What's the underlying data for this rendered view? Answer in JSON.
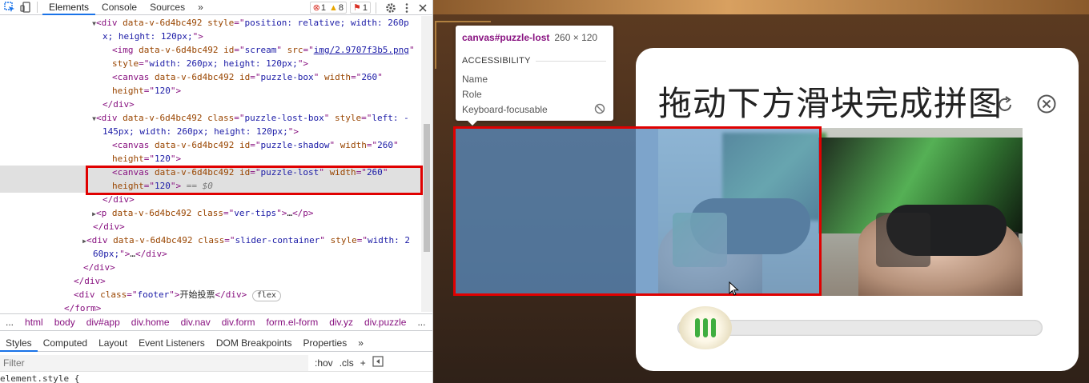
{
  "devtools": {
    "tabs": [
      "Elements",
      "Console",
      "Sources"
    ],
    "more_tabs": "»",
    "badges": {
      "errors": "1",
      "warnings": "8",
      "issues": "1"
    },
    "elements_lines": [
      {
        "indent": 120,
        "tw": "▼",
        "html": [
          [
            "tag",
            "<div "
          ],
          [
            "attr",
            "data-v-6d4bc492 style"
          ],
          [
            "tag",
            "=\""
          ],
          [
            "val",
            "position: relative; width: 260p"
          ]
        ]
      },
      {
        "indent": 128,
        "tw": "",
        "html": [
          [
            "val",
            "x; height: 120px;"
          ],
          [
            "tag",
            "\">"
          ]
        ]
      },
      {
        "indent": 140,
        "tw": "",
        "html": [
          [
            "tag",
            "<img "
          ],
          [
            "attr",
            "data-v-6d4bc492 id"
          ],
          [
            "tag",
            "=\""
          ],
          [
            "val",
            "scream"
          ],
          [
            "tag",
            "\" "
          ],
          [
            "attr",
            "src"
          ],
          [
            "tag",
            "=\""
          ],
          [
            "link",
            "img/2.9707f3b5.png"
          ],
          [
            "tag",
            "\""
          ]
        ]
      },
      {
        "indent": 140,
        "tw": "",
        "html": [
          [
            "attr",
            "style"
          ],
          [
            "tag",
            "=\""
          ],
          [
            "val",
            "width: 260px; height: 120px;"
          ],
          [
            "tag",
            "\">"
          ]
        ]
      },
      {
        "indent": 140,
        "tw": "",
        "html": [
          [
            "tag",
            "<canvas "
          ],
          [
            "attr",
            "data-v-6d4bc492 id"
          ],
          [
            "tag",
            "=\""
          ],
          [
            "val",
            "puzzle-box"
          ],
          [
            "tag",
            "\" "
          ],
          [
            "attr",
            "width"
          ],
          [
            "tag",
            "=\""
          ],
          [
            "val",
            "260"
          ],
          [
            "tag",
            "\""
          ]
        ]
      },
      {
        "indent": 140,
        "tw": "",
        "html": [
          [
            "attr",
            "height"
          ],
          [
            "tag",
            "=\""
          ],
          [
            "val",
            "120"
          ],
          [
            "tag",
            "\">"
          ]
        ]
      },
      {
        "indent": 128,
        "tw": "",
        "html": [
          [
            "tag",
            "</div>"
          ]
        ]
      },
      {
        "indent": 120,
        "tw": "▼",
        "html": [
          [
            "tag",
            "<div "
          ],
          [
            "attr",
            "data-v-6d4bc492 class"
          ],
          [
            "tag",
            "=\""
          ],
          [
            "val",
            "puzzle-lost-box"
          ],
          [
            "tag",
            "\" "
          ],
          [
            "attr",
            "style"
          ],
          [
            "tag",
            "=\""
          ],
          [
            "val",
            "left: -"
          ]
        ]
      },
      {
        "indent": 128,
        "tw": "",
        "html": [
          [
            "val",
            "145px; width: 260px; height: 120px;"
          ],
          [
            "tag",
            "\">"
          ]
        ]
      },
      {
        "indent": 140,
        "tw": "",
        "html": [
          [
            "tag",
            "<canvas "
          ],
          [
            "attr",
            "data-v-6d4bc492 id"
          ],
          [
            "tag",
            "=\""
          ],
          [
            "val",
            "puzzle-shadow"
          ],
          [
            "tag",
            "\" "
          ],
          [
            "attr",
            "width"
          ],
          [
            "tag",
            "=\""
          ],
          [
            "val",
            "260"
          ],
          [
            "tag",
            "\""
          ]
        ]
      },
      {
        "indent": 140,
        "tw": "",
        "html": [
          [
            "attr",
            "height"
          ],
          [
            "tag",
            "=\""
          ],
          [
            "val",
            "120"
          ],
          [
            "tag",
            "\">"
          ]
        ]
      },
      {
        "indent": 140,
        "tw": "",
        "sel": true,
        "html": [
          [
            "tag",
            "<canvas "
          ],
          [
            "attr",
            "data-v-6d4bc492 id"
          ],
          [
            "tag",
            "=\""
          ],
          [
            "val",
            "puzzle-lost"
          ],
          [
            "tag",
            "\" "
          ],
          [
            "attr",
            "width"
          ],
          [
            "tag",
            "=\""
          ],
          [
            "val",
            "260"
          ],
          [
            "tag",
            "\""
          ]
        ]
      },
      {
        "indent": 140,
        "tw": "",
        "sel": true,
        "html": [
          [
            "attr",
            "height"
          ],
          [
            "tag",
            "=\""
          ],
          [
            "val",
            "120"
          ],
          [
            "tag",
            "\">"
          ],
          [
            "eq",
            " == $0"
          ]
        ]
      },
      {
        "indent": 128,
        "tw": "",
        "html": [
          [
            "tag",
            "</div>"
          ]
        ]
      },
      {
        "indent": 120,
        "tw": "▶",
        "html": [
          [
            "tag",
            "<p "
          ],
          [
            "attr",
            "data-v-6d4bc492 class"
          ],
          [
            "tag",
            "=\""
          ],
          [
            "val",
            "ver-tips"
          ],
          [
            "tag",
            "\">"
          ],
          [
            "txt",
            "…"
          ],
          [
            "tag",
            "</p>"
          ]
        ]
      },
      {
        "indent": 116,
        "tw": "",
        "html": [
          [
            "tag",
            "</div>"
          ]
        ]
      },
      {
        "indent": 108,
        "tw": "▶",
        "html": [
          [
            "tag",
            "<div "
          ],
          [
            "attr",
            "data-v-6d4bc492 class"
          ],
          [
            "tag",
            "=\""
          ],
          [
            "val",
            "slider-container"
          ],
          [
            "tag",
            "\" "
          ],
          [
            "attr",
            "style"
          ],
          [
            "tag",
            "=\""
          ],
          [
            "val",
            "width: 2"
          ]
        ]
      },
      {
        "indent": 116,
        "tw": "",
        "html": [
          [
            "val",
            "60px;"
          ],
          [
            "tag",
            "\">"
          ],
          [
            "txt",
            "…"
          ],
          [
            "tag",
            "</div>"
          ]
        ]
      },
      {
        "indent": 104,
        "tw": "",
        "html": [
          [
            "tag",
            "</div>"
          ]
        ]
      },
      {
        "indent": 92,
        "tw": "",
        "html": [
          [
            "tag",
            "</div>"
          ]
        ]
      },
      {
        "indent": 92,
        "tw": "",
        "html": [
          [
            "tag",
            "<div "
          ],
          [
            "attr",
            "class"
          ],
          [
            "tag",
            "=\""
          ],
          [
            "val",
            "footer"
          ],
          [
            "tag",
            "\">"
          ],
          [
            "txt",
            "开始投票"
          ],
          [
            "tag",
            "</div> "
          ],
          [
            "pill",
            "flex"
          ]
        ]
      },
      {
        "indent": 80,
        "tw": "",
        "html": [
          [
            "tag",
            "</form>"
          ]
        ]
      }
    ],
    "breadcrumbs": [
      "...",
      "html",
      "body",
      "div#app",
      "div.home",
      "div.nav",
      "div.form",
      "form.el-form",
      "div.yz",
      "div.puzzle",
      "..."
    ],
    "styles_tabs": [
      "Styles",
      "Computed",
      "Layout",
      "Event Listeners",
      "DOM Breakpoints",
      "Properties",
      "»"
    ],
    "filter_placeholder": "Filter",
    "filter_buttons": [
      ":hov",
      ".cls",
      "+"
    ],
    "element_style": "element.style {"
  },
  "tooltip": {
    "element": "canvas#puzzle-lost",
    "dimensions": "260 × 120",
    "section": "ACCESSIBILITY",
    "rows": [
      "Name",
      "Role",
      "Keyboard-focusable"
    ]
  },
  "verify": {
    "title": "拖动下方滑块完成拼图",
    "slider_progress": 0.02
  },
  "colors": {
    "highlight": "#e00000",
    "accent": "#1a73e8",
    "slider_grip": "#3fae3f"
  },
  "icons": [
    "inspect-icon",
    "device-toggle-icon",
    "gear-icon",
    "kebab-menu-icon",
    "close-icon",
    "refresh-icon",
    "close-circle-icon",
    "not-allowed-icon",
    "cursor-icon"
  ]
}
